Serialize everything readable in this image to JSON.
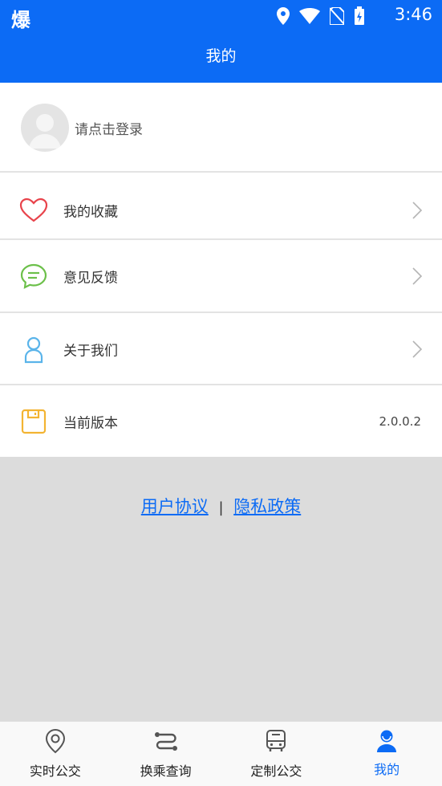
{
  "status_bar": {
    "left_glyph": "爆",
    "time": "3:46"
  },
  "header": {
    "title": "我的"
  },
  "login": {
    "text": "请点击登录"
  },
  "menu": [
    {
      "label": "我的收藏",
      "icon": "heart-icon"
    },
    {
      "label": "意见反馈",
      "icon": "chat-bubble-icon"
    },
    {
      "label": "关于我们",
      "icon": "person-icon"
    },
    {
      "label": "当前版本",
      "icon": "save-disk-icon",
      "value": "2.0.0.2"
    }
  ],
  "links": {
    "agreement": "用户协议",
    "separator": "|",
    "privacy": "隐私政策"
  },
  "tabs": [
    {
      "label": "实时公交",
      "icon": "location-pin-icon"
    },
    {
      "label": "换乘查询",
      "icon": "route-icon"
    },
    {
      "label": "定制公交",
      "icon": "bus-icon"
    },
    {
      "label": "我的",
      "icon": "user-icon",
      "active": true
    }
  ],
  "colors": {
    "primary": "#0c6bf5",
    "heart": "#e8434b",
    "chat": "#6cc04a",
    "person": "#5ab4ea",
    "disk": "#f3b432"
  }
}
